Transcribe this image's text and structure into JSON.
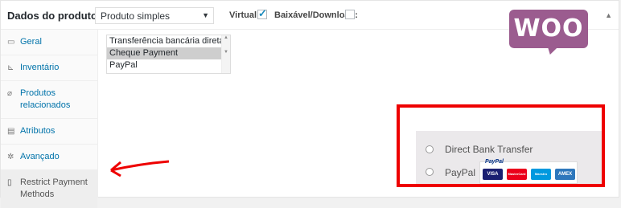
{
  "header": {
    "title": "Dados do produto —",
    "product_type": "Produto simples",
    "virtual_label": "Virtual:",
    "download_label": "Baixável/Download:",
    "virtual_checked": true,
    "download_checked": false
  },
  "sidebar": {
    "items": [
      {
        "label": "Geral",
        "icon": "wrench-icon"
      },
      {
        "label": "Inventário",
        "icon": "chart-icon"
      },
      {
        "label": "Produtos relacionados",
        "icon": "link-icon"
      },
      {
        "label": "Atributos",
        "icon": "list-icon"
      },
      {
        "label": "Avançado",
        "icon": "gear-icon"
      },
      {
        "label": "Restrict Payment Methods",
        "icon": "document-icon",
        "active": true
      }
    ]
  },
  "payment_list": {
    "options": [
      "Transferência bancária direta",
      "Cheque Payment",
      "PayPal"
    ],
    "selected": "Cheque Payment"
  },
  "logo": {
    "text": "WOO",
    "color": "#9b5c8f"
  },
  "checkout_preview": {
    "options": [
      "Direct Bank Transfer",
      "PayPal"
    ],
    "paypal_badge": "PayPal",
    "cards": [
      "VISA",
      "MasterCard",
      "Maestro",
      "AMEX"
    ]
  },
  "colors": {
    "accent": "#0073aa",
    "highlight": "#e00000"
  }
}
